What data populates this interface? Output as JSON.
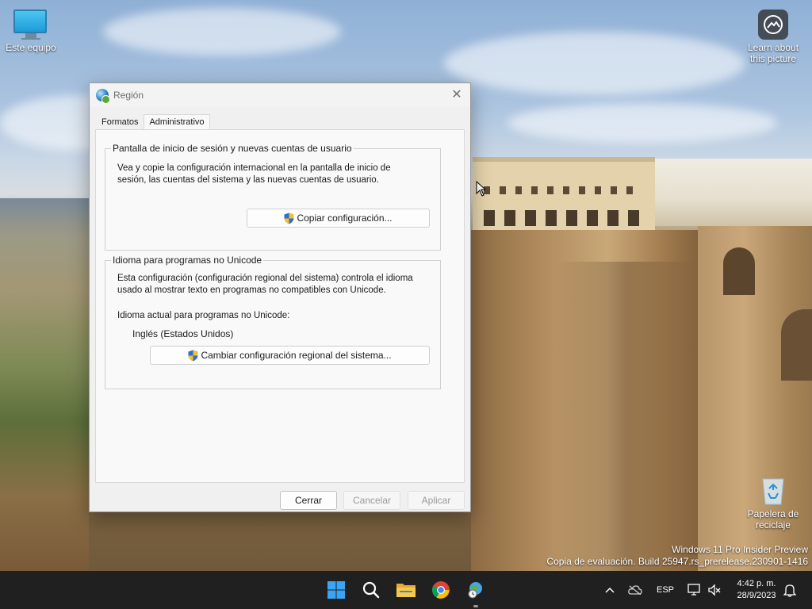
{
  "desktop": {
    "icons": {
      "this_pc": "Este equipo",
      "learn_line1": "Learn about",
      "learn_line2": "this picture",
      "recycle_line1": "Papelera de",
      "recycle_line2": "reciclaje"
    },
    "watermark": {
      "line1": "Windows 11 Pro Insider Preview",
      "line2": "Copia de evaluación. Build 25947.rs_prerelease.230901-1416"
    }
  },
  "dialog": {
    "title": "Región",
    "tabs": [
      "Formatos",
      "Administrativo"
    ],
    "active_tab": "Administrativo",
    "group_login": {
      "title": "Pantalla de inicio de sesión y nuevas cuentas de usuario",
      "line1": "Vea y copie la configuración internacional en la pantalla de inicio de",
      "line2": "sesión, las cuentas del sistema y las nuevas cuentas de usuario.",
      "button": "Copiar configuración..."
    },
    "group_unicode": {
      "title": "Idioma para programas no Unicode",
      "line1": "Esta configuración (configuración regional del sistema) controla el idioma",
      "line2": "usado al mostrar texto en programas no compatibles con Unicode.",
      "current_label": "Idioma actual para programas no Unicode:",
      "current_value": "Inglés (Estados Unidos)",
      "button": "Cambiar configuración regional del sistema..."
    },
    "footer": {
      "close": "Cerrar",
      "cancel": "Cancelar",
      "apply": "Aplicar"
    }
  },
  "taskbar": {
    "language": "ESP",
    "time": "4:42 p. m.",
    "date": "28/9/2023"
  }
}
